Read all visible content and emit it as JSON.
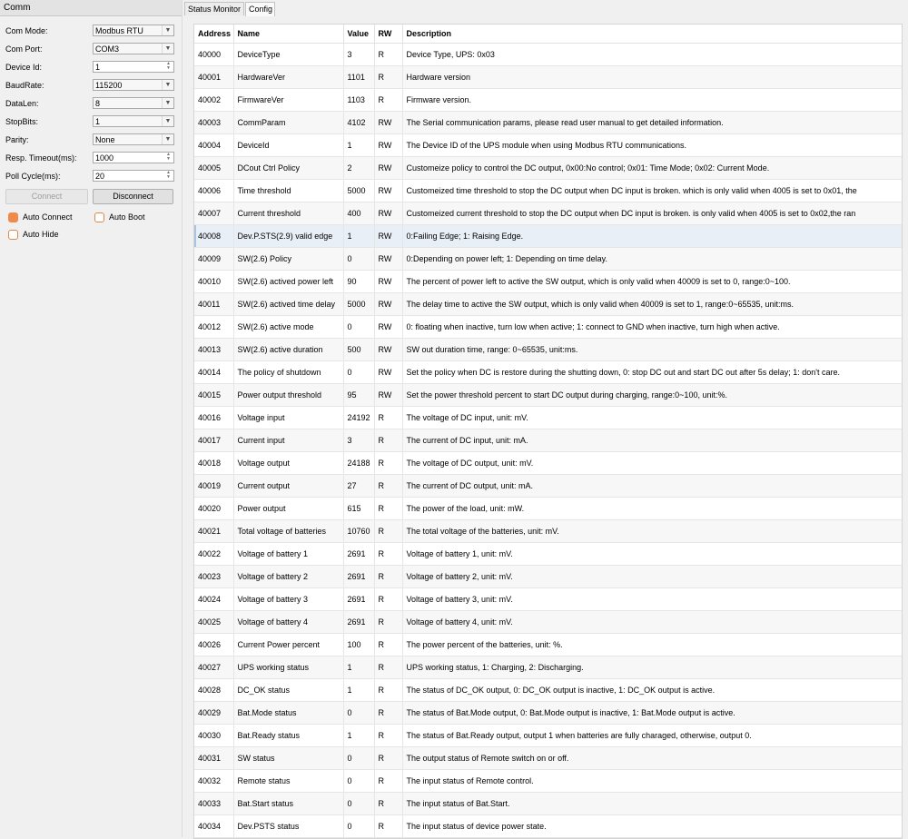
{
  "panel": {
    "title": "Comm",
    "fields": [
      {
        "label": "Com Mode:",
        "value": "Modbus RTU",
        "kind": "combo"
      },
      {
        "label": "Com Port:",
        "value": "COM3",
        "kind": "combo"
      },
      {
        "label": "Device Id:",
        "value": "1",
        "kind": "spin"
      },
      {
        "label": "BaudRate:",
        "value": "115200",
        "kind": "combo"
      },
      {
        "label": "DataLen:",
        "value": "8",
        "kind": "combo"
      },
      {
        "label": "StopBits:",
        "value": "1",
        "kind": "combo"
      },
      {
        "label": "Parity:",
        "value": "None",
        "kind": "combo"
      },
      {
        "label": "Resp. Timeout(ms):",
        "value": "1000",
        "kind": "spin"
      },
      {
        "label": "Poll Cycle(ms):",
        "value": "20",
        "kind": "spin"
      }
    ],
    "connect_label": "Connect",
    "disconnect_label": "Disconnect",
    "checks": [
      {
        "label": "Auto Connect",
        "checked": true
      },
      {
        "label": "Auto Boot",
        "checked": false
      },
      {
        "label": "Auto Hide",
        "checked": false
      }
    ]
  },
  "tabs": [
    {
      "label": "Status Monitor",
      "active": false
    },
    {
      "label": "Config",
      "active": true
    }
  ],
  "table": {
    "columns": [
      "Address",
      "Name",
      "Value",
      "RW",
      "Description"
    ],
    "selected_address": "40008",
    "rows": [
      [
        "40000",
        "DeviceType",
        "3",
        "R",
        "Device Type, UPS: 0x03"
      ],
      [
        "40001",
        "HardwareVer",
        "1101",
        "R",
        "Hardware version"
      ],
      [
        "40002",
        "FirmwareVer",
        "1103",
        "R",
        "Firmware version."
      ],
      [
        "40003",
        "CommParam",
        "4102",
        "RW",
        "The Serial communication params, please read user manual to get detailed information."
      ],
      [
        "40004",
        "DeviceId",
        "1",
        "RW",
        "The Device ID of the UPS module when using Modbus RTU communications."
      ],
      [
        "40005",
        "DCout Ctrl Policy",
        "2",
        "RW",
        "Customeize policy to control the DC output, 0x00:No control; 0x01: Time Mode; 0x02: Current Mode."
      ],
      [
        "40006",
        "Time threshold",
        "5000",
        "RW",
        "Customeized time threshold to stop the DC output when DC input is broken. which is only valid when 4005 is set to 0x01, the"
      ],
      [
        "40007",
        "Current threshold",
        "400",
        "RW",
        "Customeized current threshold to stop the DC output when DC input is broken. is only valid when 4005 is set to 0x02,the ran"
      ],
      [
        "40008",
        "Dev.P.STS(2.9) valid edge",
        "1",
        "RW",
        "0:Failing Edge; 1: Raising Edge."
      ],
      [
        "40009",
        "SW(2.6) Policy",
        "0",
        "RW",
        "0:Depending on power left; 1: Depending on time delay."
      ],
      [
        "40010",
        "SW(2.6) actived power left",
        "90",
        "RW",
        "The percent of power left to active the SW output, which is only valid when 40009 is set to 0, range:0~100."
      ],
      [
        "40011",
        "SW(2.6) actived time delay",
        "5000",
        "RW",
        "The delay time to active the SW output, which is only valid when 40009 is set to 1, range:0~65535, unit:ms."
      ],
      [
        "40012",
        "SW(2.6) active mode",
        "0",
        "RW",
        "0: floating when inactive, turn low when active; 1: connect to GND when inactive, turn high when active."
      ],
      [
        "40013",
        "SW(2.6) active duration",
        "500",
        "RW",
        "SW out duration time, range: 0~65535, unit:ms."
      ],
      [
        "40014",
        "The policy of shutdown",
        "0",
        "RW",
        "Set the policy when DC is restore during the shutting down, 0: stop DC out and start DC out after 5s delay; 1: don't care."
      ],
      [
        "40015",
        "Power output threshold",
        "95",
        "RW",
        "Set the power threshold percent to start DC output during charging, range:0~100, unit:%."
      ],
      [
        "40016",
        "Voltage input",
        "24192",
        "R",
        "The voltage of DC input, unit: mV."
      ],
      [
        "40017",
        "Current input",
        "3",
        "R",
        "The current of DC input, unit: mA."
      ],
      [
        "40018",
        "Voltage output",
        "24188",
        "R",
        "The voltage of DC output, unit: mV."
      ],
      [
        "40019",
        "Current output",
        "27",
        "R",
        "The current of DC output, unit: mA."
      ],
      [
        "40020",
        "Power output",
        "615",
        "R",
        "The power of the load, unit: mW."
      ],
      [
        "40021",
        "Total voltage of batteries",
        "10760",
        "R",
        "The total voltage of the batteries, unit: mV."
      ],
      [
        "40022",
        "Voltage of battery 1",
        "2691",
        "R",
        "Voltage of battery 1, unit: mV."
      ],
      [
        "40023",
        "Voltage of battery 2",
        "2691",
        "R",
        "Voltage of battery 2, unit: mV."
      ],
      [
        "40024",
        "Voltage of battery 3",
        "2691",
        "R",
        "Voltage of battery 3, unit: mV."
      ],
      [
        "40025",
        "Voltage of battery 4",
        "2691",
        "R",
        "Voltage of battery 4, unit: mV."
      ],
      [
        "40026",
        "Current Power percent",
        "100",
        "R",
        "The power percent of the batteries, unit: %."
      ],
      [
        "40027",
        "UPS working status",
        "1",
        "R",
        "UPS working status, 1: Charging, 2: Discharging."
      ],
      [
        "40028",
        "DC_OK status",
        "1",
        "R",
        "The status of DC_OK output, 0: DC_OK output is inactive, 1: DC_OK output is active."
      ],
      [
        "40029",
        "Bat.Mode status",
        "0",
        "R",
        "The status of Bat.Mode output, 0: Bat.Mode output is inactive, 1: Bat.Mode output is active."
      ],
      [
        "40030",
        "Bat.Ready status",
        "1",
        "R",
        "The status of Bat.Ready output, output 1 when batteries are fully charaged, otherwise, output 0."
      ],
      [
        "40031",
        "SW status",
        "0",
        "R",
        "The output status of Remote switch on or off."
      ],
      [
        "40032",
        "Remote status",
        "0",
        "R",
        "The input status of Remote control."
      ],
      [
        "40033",
        "Bat.Start status",
        "0",
        "R",
        "The input status of Bat.Start."
      ],
      [
        "40034",
        "Dev.PSTS status",
        "0",
        "R",
        "The input status of device power state."
      ]
    ]
  }
}
